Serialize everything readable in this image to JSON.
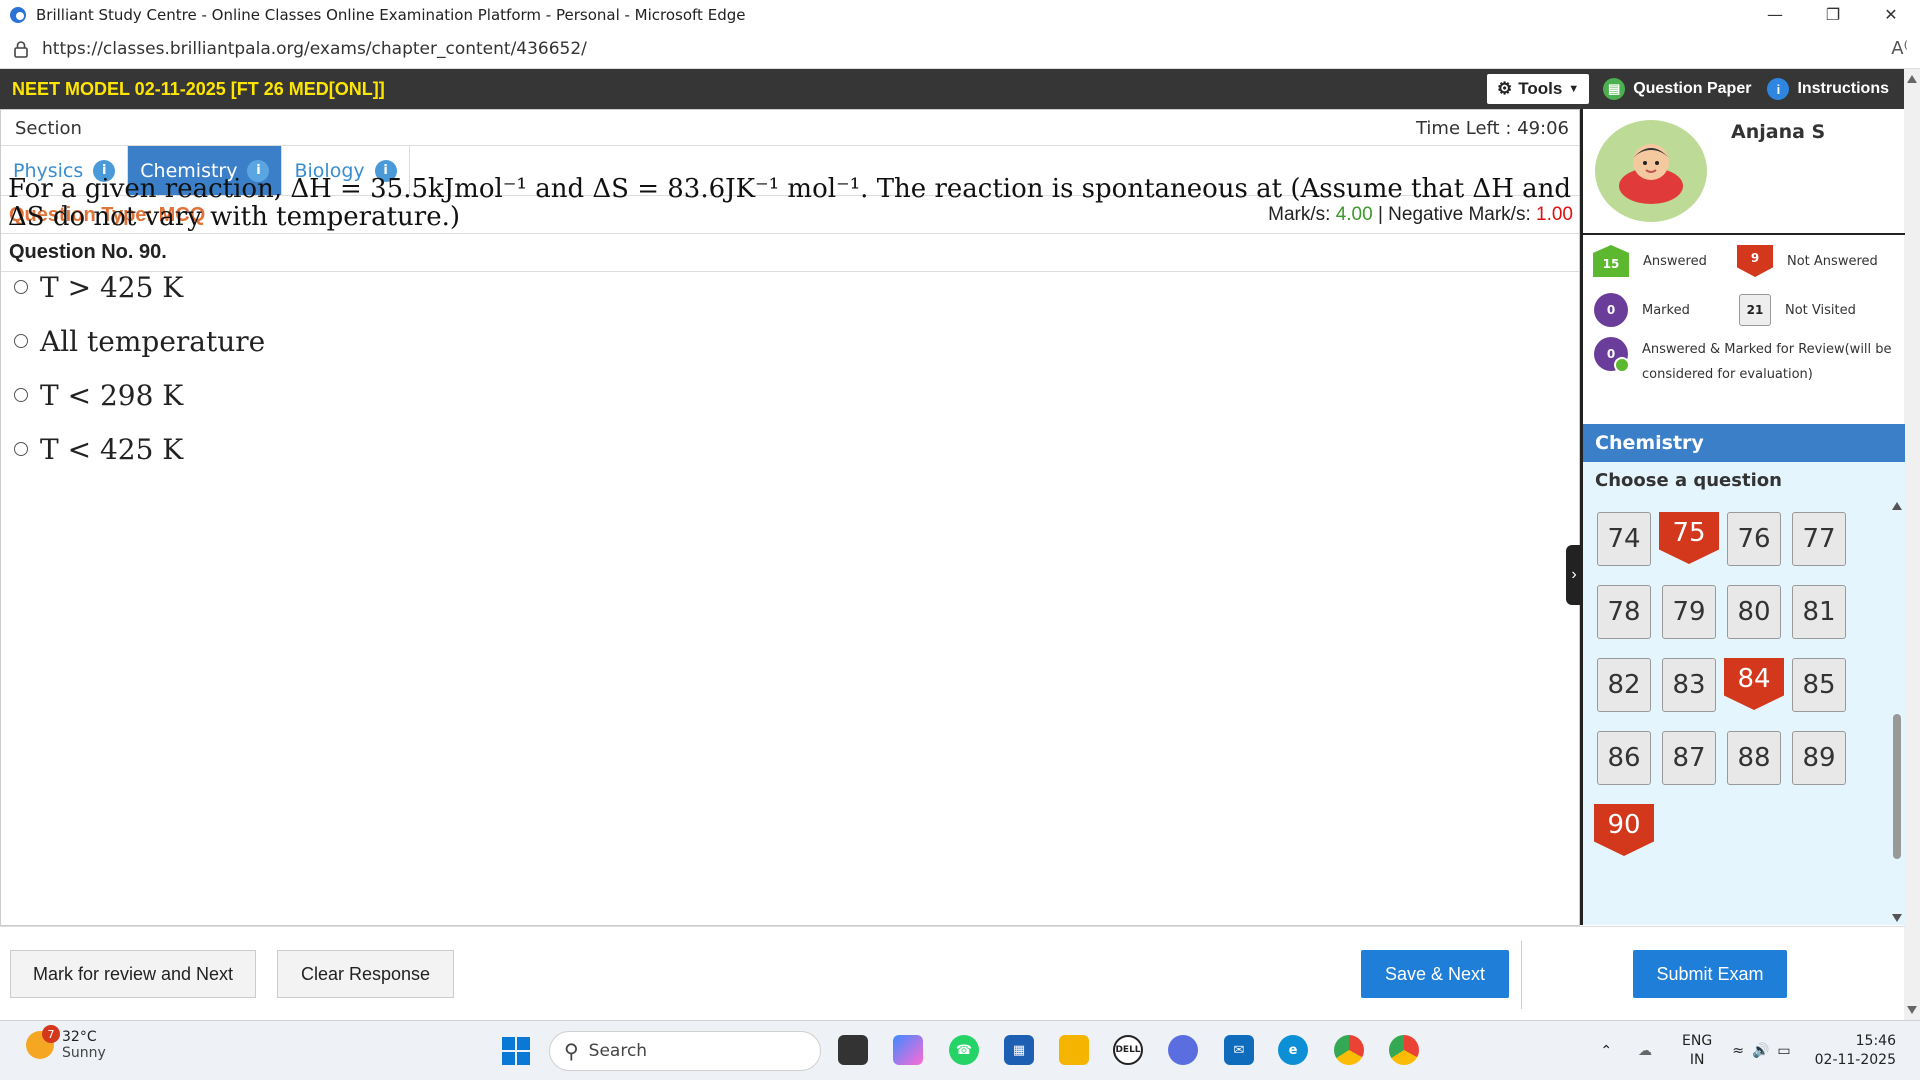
{
  "browser": {
    "window_title": "Brilliant Study Centre - Online Classes Online Examination Platform - Personal - Microsoft Edge",
    "url": "https://classes.brilliantpala.org/exams/chapter_content/436652/"
  },
  "exam": {
    "title": "NEET MODEL 02-11-2025 [FT 26 MED[ONL]]",
    "tools_label": "Tools",
    "question_paper_label": "Question Paper",
    "instructions_label": "Instructions",
    "section_label": "Section",
    "time_left_label": "Time Left : 49:06",
    "tabs": [
      {
        "label": "Physics",
        "active": false
      },
      {
        "label": "Chemistry",
        "active": true
      },
      {
        "label": "Biology",
        "active": false
      }
    ],
    "question_type": "Question Type: MCQ",
    "marks_prefix": "Mark/s: ",
    "marks_value": "4.00",
    "neg_prefix": " | Negative Mark/s: ",
    "neg_value": "1.00",
    "question_no": "Question No. 90.",
    "question_text": "For a given reaction, ΔH = 35.5kJmol⁻¹ and ΔS = 83.6JK⁻¹ mol⁻¹. The reaction is spontaneous at (Assume that ΔH and ΔS do not vary with temperature.)",
    "options": [
      "T > 425 K",
      "All temperature",
      "T < 298 K",
      "T < 425 K"
    ]
  },
  "panel": {
    "user_name": "Anjana S",
    "legend": {
      "answered_count": "15",
      "answered_label": "Answered",
      "not_answered_count": "9",
      "not_answered_label": "Not Answered",
      "marked_count": "0",
      "marked_label": "Marked",
      "not_visited_count": "21",
      "not_visited_label": "Not Visited",
      "amr_count": "0",
      "amr_label_1": "Answered & Marked for Review(will be",
      "amr_label_2": "considered for evaluation)"
    },
    "section_name": "Chemistry",
    "choose_label": "Choose a question",
    "questions": [
      {
        "n": "74",
        "status": "nv"
      },
      {
        "n": "75",
        "status": "na"
      },
      {
        "n": "76",
        "status": "nv"
      },
      {
        "n": "77",
        "status": "nv"
      },
      {
        "n": "78",
        "status": "nv"
      },
      {
        "n": "79",
        "status": "nv"
      },
      {
        "n": "80",
        "status": "nv"
      },
      {
        "n": "81",
        "status": "nv"
      },
      {
        "n": "82",
        "status": "nv"
      },
      {
        "n": "83",
        "status": "nv"
      },
      {
        "n": "84",
        "status": "na"
      },
      {
        "n": "85",
        "status": "nv"
      },
      {
        "n": "86",
        "status": "nv"
      },
      {
        "n": "87",
        "status": "nv"
      },
      {
        "n": "88",
        "status": "nv"
      },
      {
        "n": "89",
        "status": "nv"
      },
      {
        "n": "90",
        "status": "na"
      }
    ]
  },
  "actions": {
    "mark_review": "Mark for review and Next",
    "clear": "Clear Response",
    "save_next": "Save & Next",
    "submit": "Submit Exam"
  },
  "taskbar": {
    "temp": "32°C",
    "weather": "Sunny",
    "weather_badge": "7",
    "search_placeholder": "Search",
    "lang1": "ENG",
    "lang2": "IN",
    "time": "15:46",
    "date": "02-11-2025"
  },
  "colors": {
    "accent_blue": "#3a7fc7",
    "answered_green": "#5cb82e",
    "not_answered_red": "#d3371c",
    "marked_purple": "#6b3d9a",
    "title_yellow": "#ffe600"
  }
}
